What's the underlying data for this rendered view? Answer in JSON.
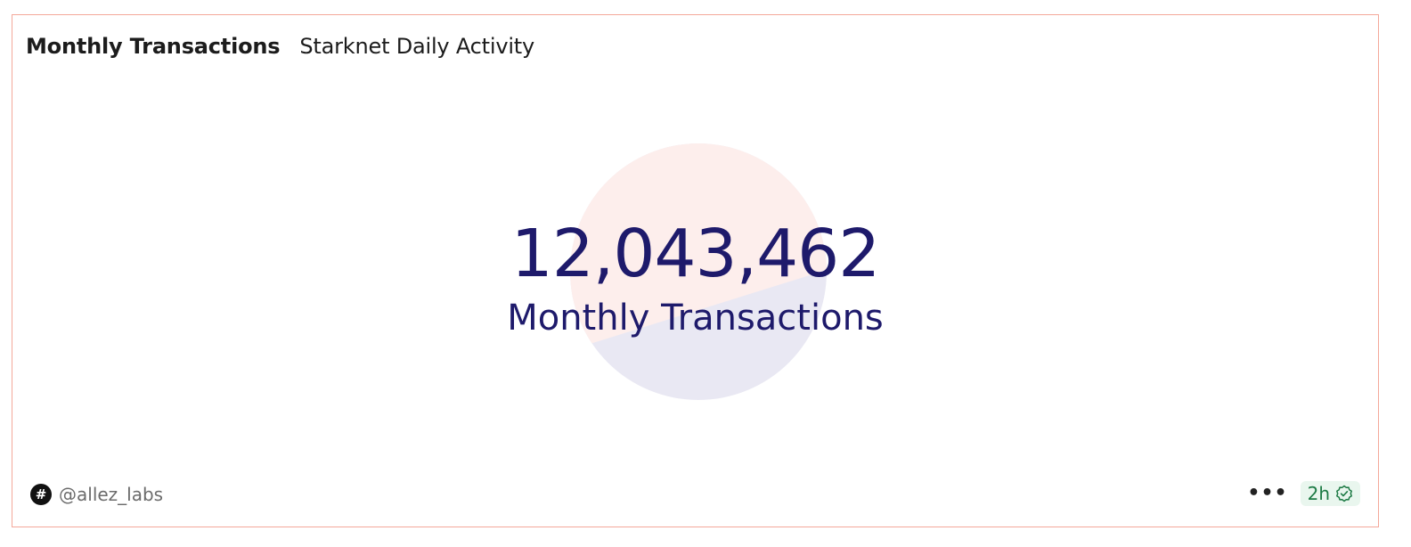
{
  "header": {
    "title": "Monthly Transactions",
    "subtitle": "Starknet Daily Activity"
  },
  "counter": {
    "value": "12,043,462",
    "label": "Monthly Transactions"
  },
  "footer": {
    "author": "@allez_labs",
    "avatar_icon": "hash-icon",
    "more_icon": "ellipsis-icon",
    "refresh_age": "2h",
    "refresh_icon": "verified-check-icon"
  },
  "colors": {
    "card_border": "#f4a89a",
    "counter_text": "#1e1a6b",
    "circle_top": "#fdeeec",
    "circle_bottom": "#e9e8f3",
    "badge_bg": "#e9f6ee",
    "badge_text": "#1c7a44"
  }
}
